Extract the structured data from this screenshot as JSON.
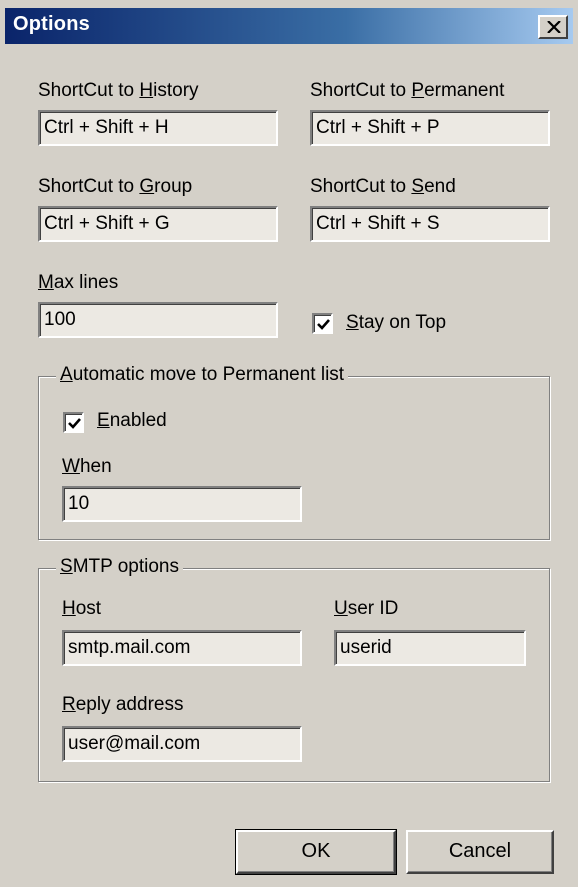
{
  "window": {
    "title": "Options"
  },
  "shortcuts": {
    "history": {
      "pre": "ShortCut to ",
      "key": "H",
      "post": "istory",
      "value": "Ctrl + Shift + H"
    },
    "permanent": {
      "pre": "ShortCut to ",
      "key": "P",
      "post": "ermanent",
      "value": "Ctrl + Shift + P"
    },
    "group": {
      "pre": "ShortCut to ",
      "key": "G",
      "post": "roup",
      "value": "Ctrl + Shift + G"
    },
    "send": {
      "pre": "ShortCut to ",
      "key": "S",
      "post": "end",
      "value": "Ctrl + Shift + S"
    }
  },
  "max_lines": {
    "key": "M",
    "post": "ax lines",
    "value": "100"
  },
  "stay_on_top": {
    "key": "S",
    "post": "tay on Top",
    "checked": true
  },
  "auto_move": {
    "legend_key": "A",
    "legend_post": "utomatic move to Permanent list",
    "enabled_key": "E",
    "enabled_post": "nabled",
    "enabled_checked": true,
    "when_key": "W",
    "when_post": "hen",
    "when_value": "10"
  },
  "smtp": {
    "legend_key": "S",
    "legend_post": "MTP options",
    "host_key": "H",
    "host_post": "ost",
    "host_value": "smtp.mail.com",
    "userid_key": "U",
    "userid_post": "ser ID",
    "userid_value": "userid",
    "reply_key": "R",
    "reply_post": "eply address",
    "reply_value": "user@mail.com"
  },
  "buttons": {
    "ok": "OK",
    "cancel": "Cancel"
  }
}
